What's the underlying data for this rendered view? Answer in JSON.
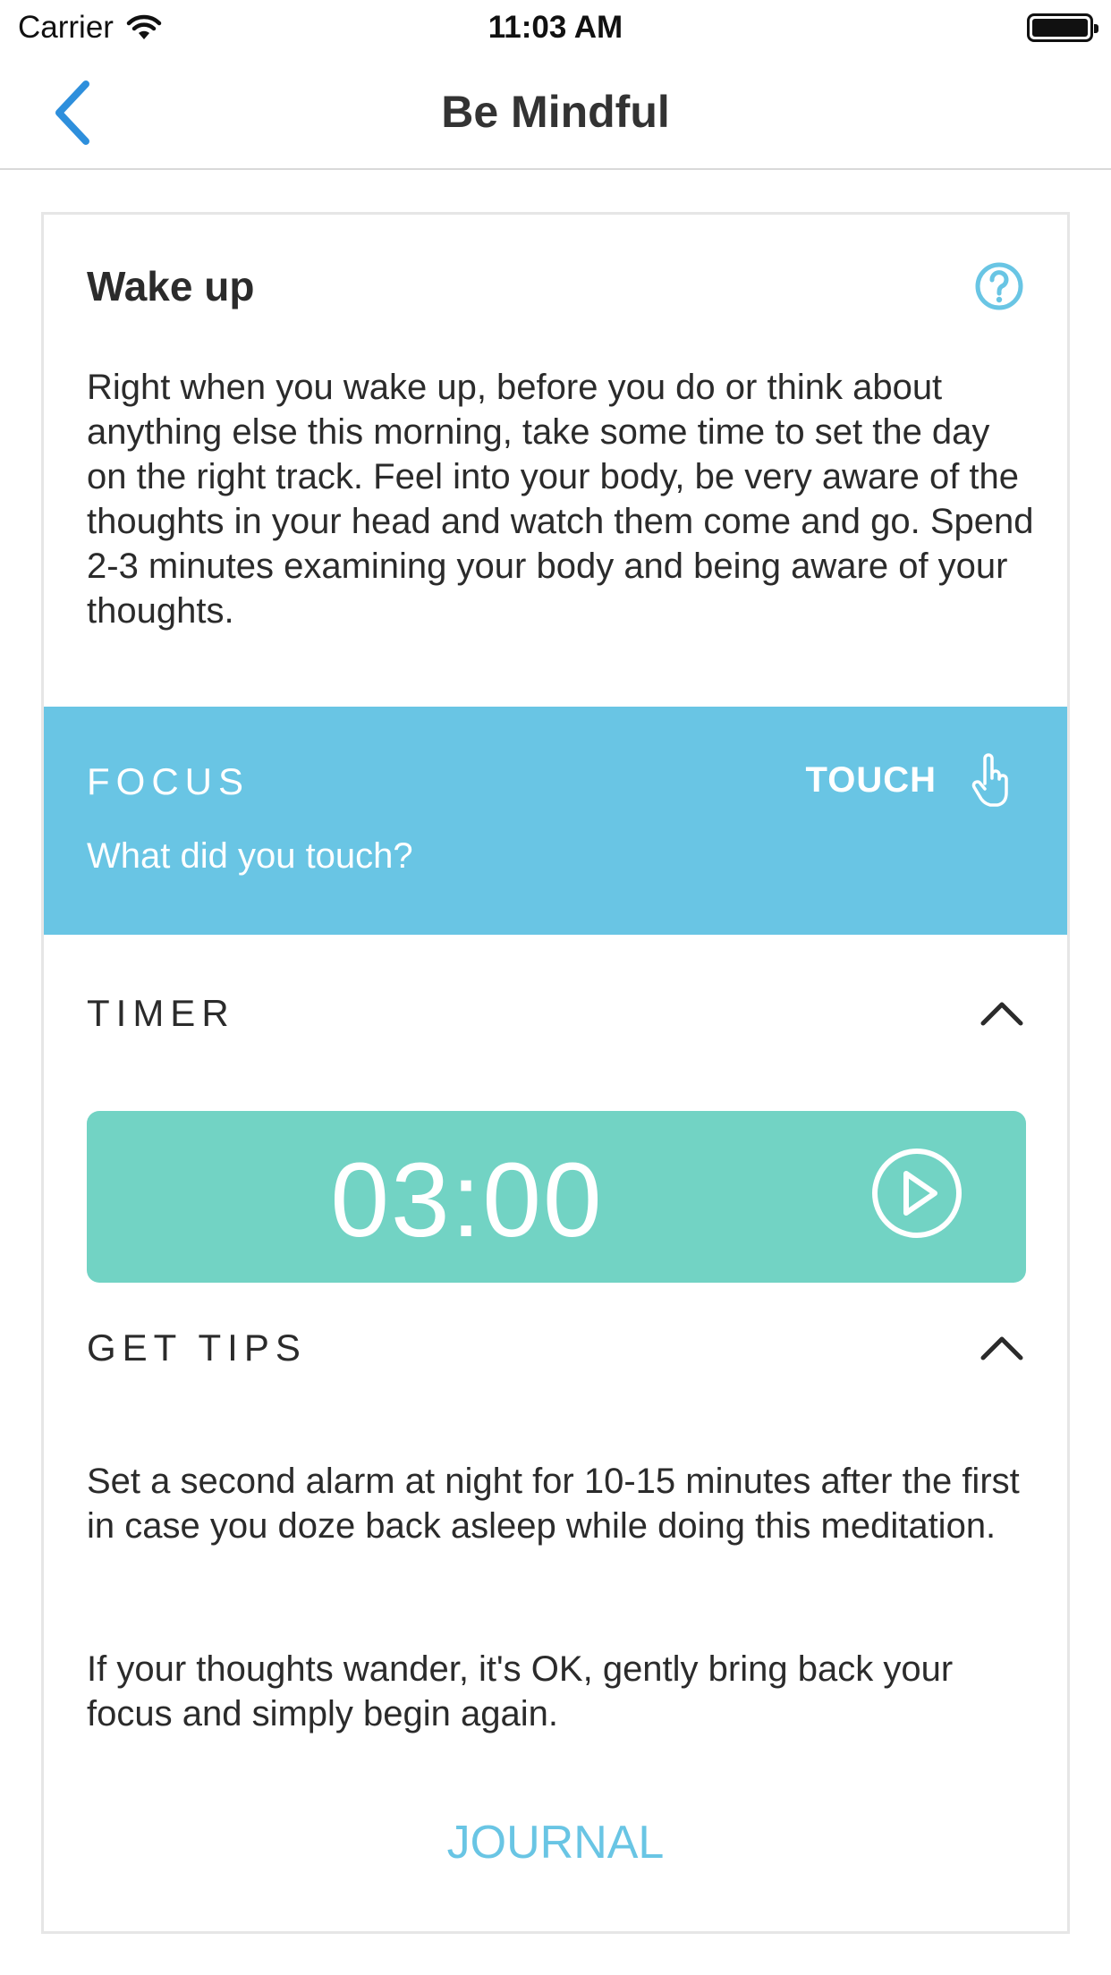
{
  "status_bar": {
    "carrier": "Carrier",
    "time": "11:03 AM"
  },
  "nav": {
    "title": "Be Mindful",
    "back_icon": "chevron-left-icon",
    "accent_color": "#2e8fdc"
  },
  "card": {
    "title": "Wake up",
    "help_icon": "question-circle-icon",
    "description": "Right when you wake up, before you do or think about anything else this morning, take some time to set the day on the right track. Feel into your body, be very aware of the thoughts in your head and watch them come and go. Spend 2-3 minutes examining your body and being aware of your thoughts."
  },
  "focus": {
    "label": "FOCUS",
    "prompt": "What did you touch?",
    "sense": "TOUCH",
    "sense_icon": "hand-pointer-icon",
    "color": "#69c5e4"
  },
  "timer": {
    "label": "TIMER",
    "value": "03:00",
    "play_icon": "play-circle-icon",
    "color": "#72d3c4"
  },
  "tips": {
    "label": "GET TIPS",
    "items": [
      "Set a second alarm at night for 10-15 minutes after the first in case you doze back asleep while doing this meditation.",
      "If your thoughts wander, it's OK, gently bring back your focus and simply begin again."
    ]
  },
  "journal": {
    "label": "JOURNAL"
  }
}
